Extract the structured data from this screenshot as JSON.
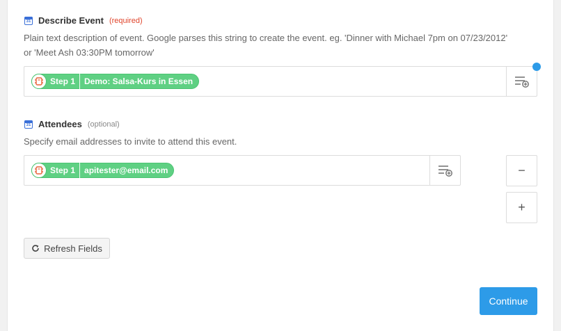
{
  "describe_event": {
    "label": "Describe Event",
    "required_tag": "(required)",
    "help_line1": "Plain text description of event. Google parses this string to create the event. eg. 'Dinner with Michael 7pm on 07/23/2012'",
    "help_line2": "or 'Meet Ash 03:30PM tomorrow'",
    "pill": {
      "step": "Step 1",
      "value": "Demo: Salsa-Kurs in Essen"
    }
  },
  "attendees": {
    "label": "Attendees",
    "optional_tag": "(optional)",
    "help": "Specify email addresses to invite to attend this event.",
    "pill": {
      "step": "Step 1",
      "value": "apitester@email.com"
    },
    "remove_label": "−",
    "add_label": "+"
  },
  "icons": {
    "calendar": "google-calendar-icon",
    "app": "zapier-app-icon",
    "insert": "insert-field-icon",
    "refresh": "refresh-icon"
  },
  "calendar_badge": "31",
  "buttons": {
    "refresh": "Refresh Fields",
    "continue": "Continue"
  },
  "colors": {
    "accent": "#2d9be8",
    "pill": "#5fd083",
    "required": "#e0452c"
  }
}
